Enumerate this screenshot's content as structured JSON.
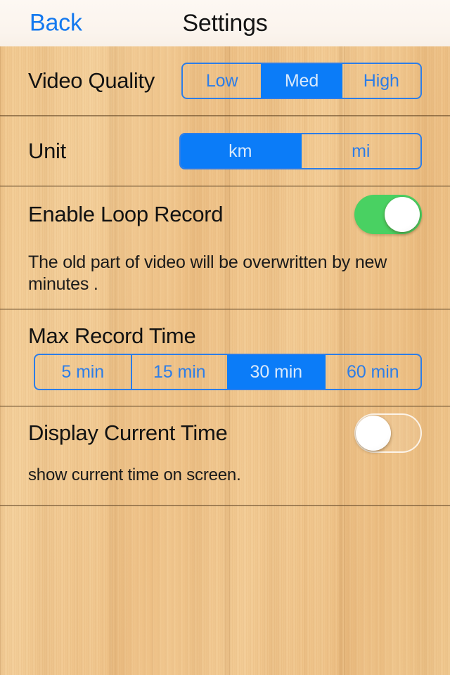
{
  "navbar": {
    "back_label": "Back",
    "title": "Settings"
  },
  "theme": {
    "accent_blue": "#0b7cf8",
    "segment_border": "#2c7de8",
    "toggle_on_green": "#49d162",
    "link_blue": "#1479ef",
    "navbar_bg": "#fbf4ed",
    "text_dark": "#121212"
  },
  "sections": {
    "video_quality": {
      "label": "Video Quality",
      "options": [
        "Low",
        "Med",
        "High"
      ],
      "selected": "Med"
    },
    "unit": {
      "label": "Unit",
      "options": [
        "km",
        "mi"
      ],
      "selected": "km"
    },
    "loop_record": {
      "label": "Enable Loop Record",
      "toggle_state": "on",
      "description": "The old part of video will be overwritten by new minutes ."
    },
    "max_record_time": {
      "label": "Max Record Time",
      "options": [
        "5 min",
        "15 min",
        "30 min",
        "60 min"
      ],
      "selected": "30 min"
    },
    "display_current_time": {
      "label": "Display Current Time",
      "toggle_state": "off",
      "description": "show current time on screen."
    }
  }
}
